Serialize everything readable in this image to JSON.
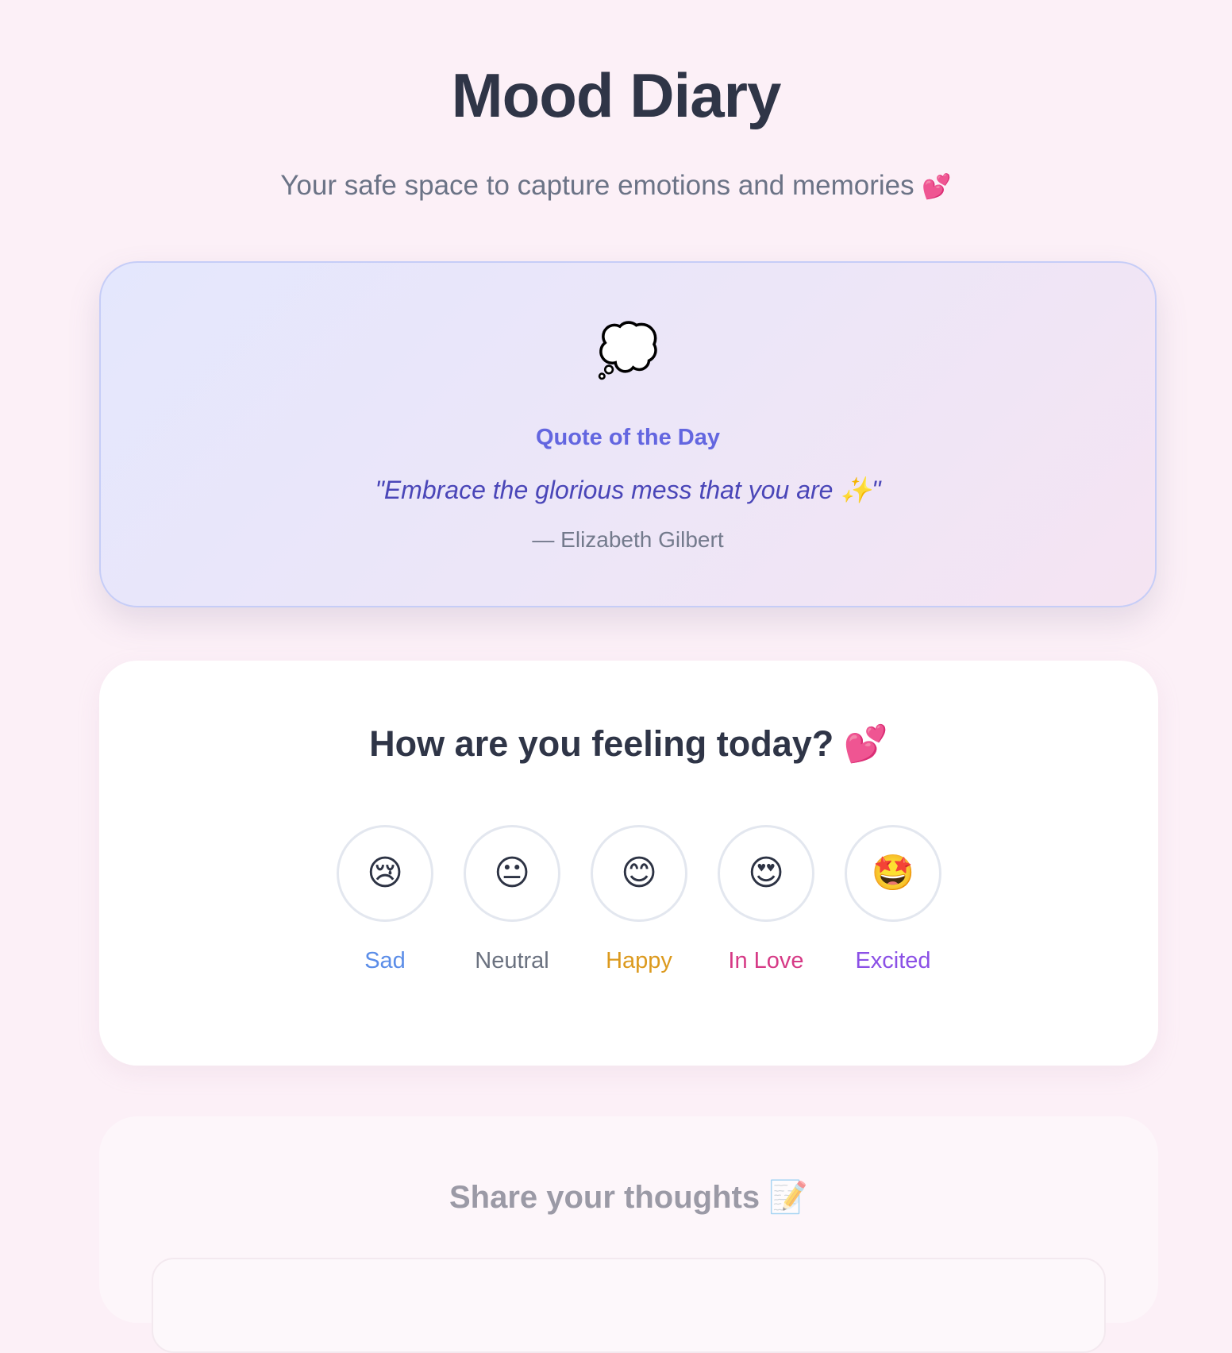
{
  "header": {
    "title": "Mood Diary",
    "subtitle": "Your safe space to capture emotions and memories",
    "subtitle_emoji": "💕"
  },
  "quote": {
    "icon": "💭",
    "label": "Quote of the Day",
    "text": "\"Embrace the glorious mess that you are ✨\"",
    "author": "— Elizabeth Gilbert"
  },
  "mood": {
    "heading": "How are you feeling today?",
    "heading_emoji": "💕",
    "options": [
      {
        "emoji": "😢",
        "label": "Sad",
        "color": "#5b8de8"
      },
      {
        "emoji": "😐",
        "label": "Neutral",
        "color": "#6b7280"
      },
      {
        "emoji": "😊",
        "label": "Happy",
        "color": "#dc9a1e"
      },
      {
        "emoji": "😍",
        "label": "In Love",
        "color": "#d63a86"
      },
      {
        "emoji": "🤩",
        "label": "Excited",
        "color": "#8b50e6"
      }
    ]
  },
  "thoughts": {
    "heading": "Share your thoughts",
    "heading_emoji": "📝"
  },
  "colors": {
    "background": "#fcf0f7",
    "accent": "#6366e0"
  }
}
